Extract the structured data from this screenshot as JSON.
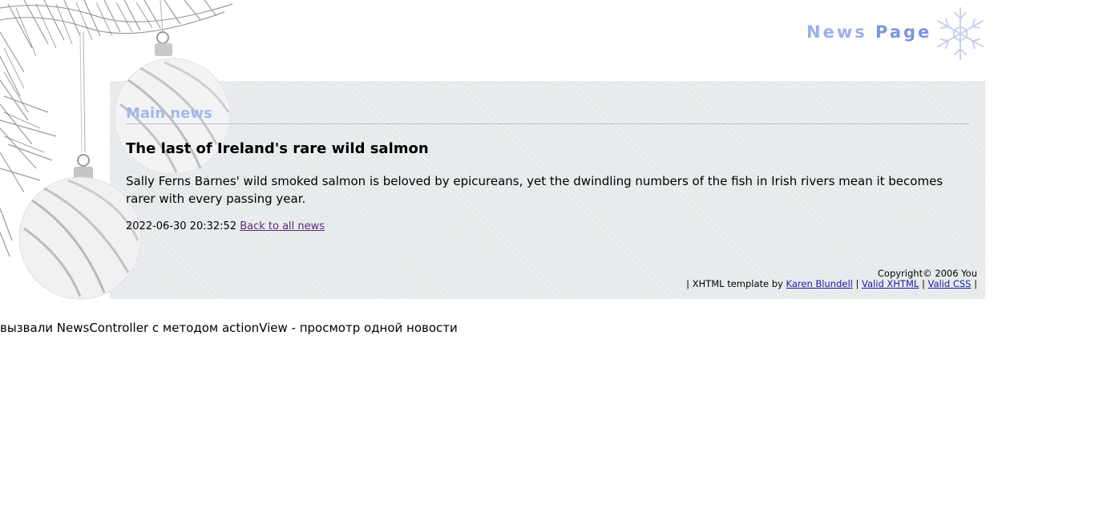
{
  "header": {
    "title_part1": "News",
    "title_part2": "Page"
  },
  "main": {
    "section_title": "Main news",
    "article": {
      "title": "The last of Ireland's rare wild salmon",
      "body": "Sally Ferns Barnes' wild smoked salmon is beloved by epicureans, yet the dwindling numbers of the fish in Irish rivers mean it becomes rarer with every passing year.",
      "timestamp": "2022-06-30 20:32:52",
      "back_link": "Back to all news"
    }
  },
  "footer": {
    "copyright": "Copyright© 2006 You",
    "template_prefix": "| XHTML template by",
    "author_link": "Karen Blundell",
    "sep1": "|",
    "valid_xhtml": "Valid XHTML",
    "sep2": "|",
    "valid_css": "Valid CSS",
    "sep3": "|"
  },
  "debug_text": "вызвали NewsController с методом actionView - просмотр одной новости",
  "colors": {
    "title_light": "#9bb0ea",
    "title_dark": "#7d94de",
    "section_title": "#a3b8ec",
    "visited_link": "#5a2d7a",
    "link": "#1a1aa6"
  },
  "icons": {
    "ornaments": "christmas-ornaments-decoration",
    "snowflake": "snowflake-icon"
  }
}
